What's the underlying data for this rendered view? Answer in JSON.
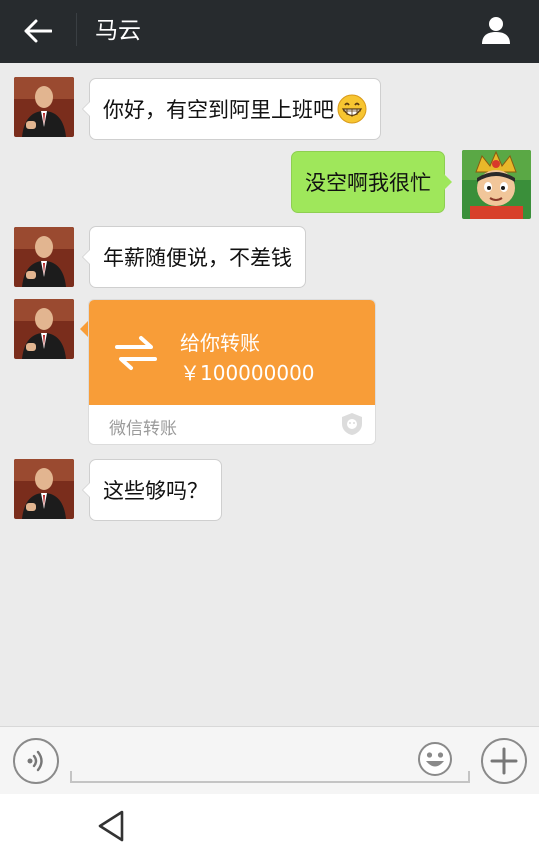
{
  "header": {
    "title": "马云",
    "back_icon": "arrow-left-icon",
    "contact_icon": "person-icon"
  },
  "messages": [
    {
      "side": "left",
      "text": "你好，有空到阿里上班吧",
      "emoji": "grinning-face-icon"
    },
    {
      "side": "right",
      "text": "没空啊我很忙"
    },
    {
      "side": "left",
      "text": "年薪随便说，不差钱"
    },
    {
      "side": "left",
      "type": "transfer",
      "title": "给你转账",
      "amount": "￥100000000",
      "source": "微信转账"
    },
    {
      "side": "left",
      "text": "这些够吗？"
    }
  ],
  "input_bar": {
    "voice_icon": "voice-icon",
    "placeholder": "",
    "emoji_icon": "emoji-icon",
    "plus_icon": "plus-icon"
  },
  "navbar": {
    "back_icon": "triangle-back-icon"
  },
  "colors": {
    "header_bg": "#272b2e",
    "chat_bg": "#ebebeb",
    "sent_bubble": "#9fe75b",
    "received_bubble": "#ffffff",
    "transfer_orange": "#f89d38"
  }
}
